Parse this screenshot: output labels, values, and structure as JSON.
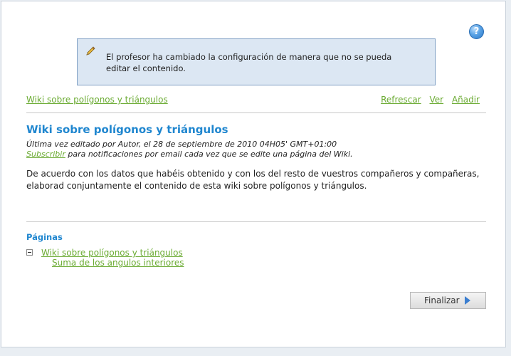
{
  "help": {
    "icon": "help-icon",
    "glyph": "?"
  },
  "notice": {
    "icon": "pencil-icon",
    "line1": "El profesor ha cambiado la configuración de manera que no se pueda",
    "line2": "editar el contenido."
  },
  "breadcrumb": {
    "label": "Wiki sobre polígonos y triángulos"
  },
  "actions": {
    "refresh": "Refrescar",
    "view": "Ver",
    "add": "Añadir"
  },
  "page": {
    "title": "Wiki sobre polígonos y triángulos",
    "last_edited": "Última vez editado por Autor, el 28 de septiembre de 2010 04H05' GMT+01:00",
    "subscribe_link": "Subscribir",
    "subscribe_text": " para notificaciones por email cada vez que se edite una página del Wiki.",
    "body": "De acuerdo con los datos que habéis obtenido y con los del resto de vuestros compañeros y compañeras, elaborad conjuntamente el contenido de esta wiki sobre polígonos y triángulos."
  },
  "pages": {
    "title": "Páginas",
    "items": [
      {
        "label": "Wiki sobre polígonos y triángulos"
      },
      {
        "label": "Suma de los angulos interiores"
      }
    ]
  },
  "finish": {
    "label": "Finalizar"
  },
  "colors": {
    "link": "#6bab33",
    "heading": "#1f86cf",
    "notice_bg": "#dce7f3"
  }
}
